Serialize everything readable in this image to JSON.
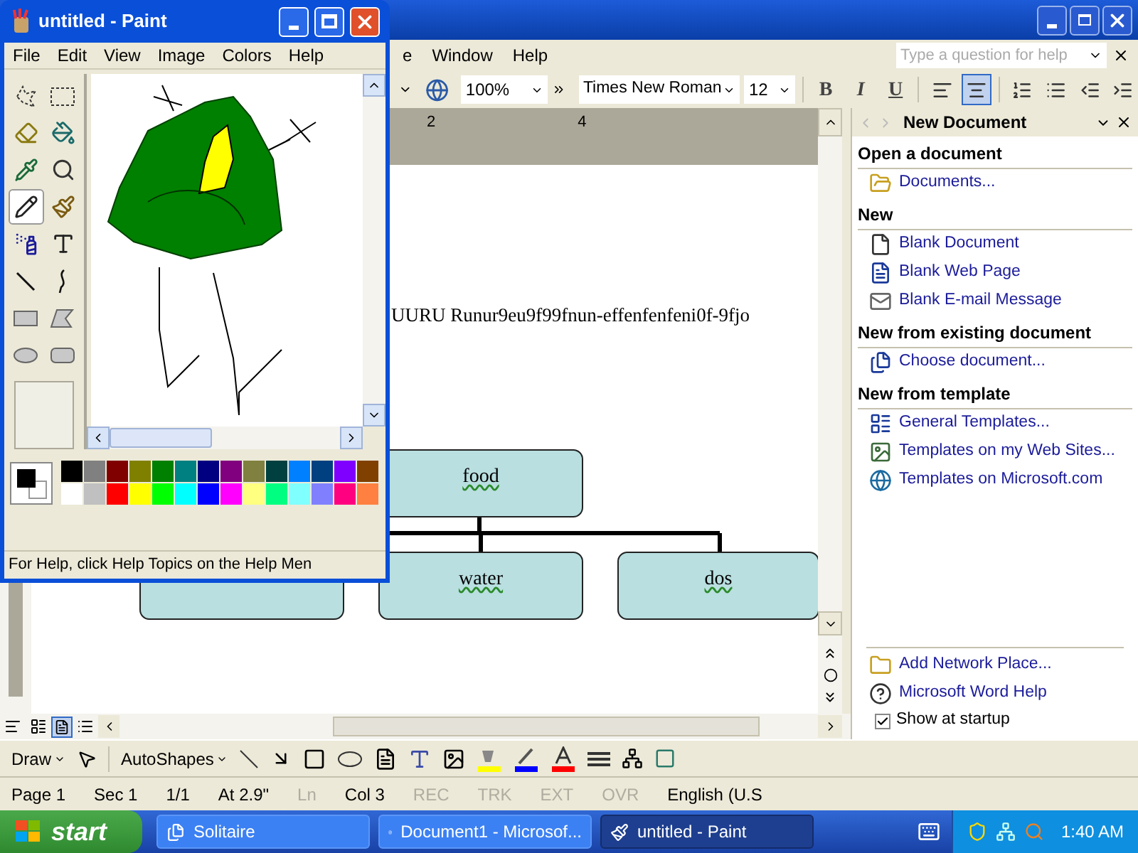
{
  "word": {
    "menu": [
      {
        "label": "e"
      },
      {
        "label": "Window"
      },
      {
        "label": "Help"
      }
    ],
    "help_box": {
      "placeholder": "Type a question for help"
    },
    "toolbar": {
      "zoom": "100%",
      "font": "Times New Roman",
      "size": "12",
      "format_buttons": [
        {
          "kind": "bold",
          "label": "B",
          "selected": false
        },
        {
          "kind": "italic",
          "label": "I",
          "selected": false
        },
        {
          "kind": "underline",
          "label": "U",
          "selected": false
        }
      ],
      "align_buttons": [
        {
          "kind": "left",
          "selected": false
        },
        {
          "kind": "center",
          "selected": true
        }
      ]
    },
    "ruler": {
      "labels": [
        "2",
        "4"
      ]
    },
    "document": {
      "text": "UURU Runur9eu9f99fnun-effenfenfeni0f-9fjo",
      "org_chart": {
        "top": {
          "label": "food"
        },
        "children": [
          {
            "label": "water"
          },
          {
            "label": "dos"
          }
        ]
      }
    },
    "task_pane": {
      "title": "New Document",
      "sections": [
        {
          "heading": "Open a document",
          "items": [
            {
              "kind": "folder",
              "label": "Documents..."
            }
          ]
        },
        {
          "heading": "New",
          "items": [
            {
              "kind": "page",
              "label": "Blank Document"
            },
            {
              "kind": "webpage",
              "label": "Blank Web Page"
            },
            {
              "kind": "mail",
              "label": "Blank E-mail Message"
            }
          ]
        },
        {
          "heading": "New from existing document",
          "items": [
            {
              "kind": "existing",
              "label": "Choose document..."
            }
          ]
        },
        {
          "heading": "New from template",
          "items": [
            {
              "kind": "template",
              "label": "General Templates..."
            },
            {
              "kind": "websites",
              "label": "Templates on my Web Sites..."
            },
            {
              "kind": "globe",
              "label": "Templates on Microsoft.com"
            }
          ]
        }
      ],
      "footer": [
        {
          "kind": "network",
          "label": "Add Network Place..."
        },
        {
          "kind": "help",
          "label": "Microsoft Word Help"
        }
      ],
      "show_at_startup": {
        "label": "Show at startup",
        "checked": true
      }
    },
    "drawing_toolbar": {
      "draw": "Draw",
      "autoshapes": "AutoShapes"
    },
    "status_bar": [
      {
        "text": "Page 1",
        "disabled": false
      },
      {
        "text": "Sec 1",
        "disabled": false
      },
      {
        "text": "1/1",
        "disabled": false
      },
      {
        "text": "At 2.9\"",
        "disabled": false
      },
      {
        "text": "Ln",
        "disabled": true
      },
      {
        "text": "Col 3",
        "disabled": false
      },
      {
        "text": "REC",
        "disabled": true
      },
      {
        "text": "TRK",
        "disabled": true
      },
      {
        "text": "EXT",
        "disabled": true
      },
      {
        "text": "OVR",
        "disabled": true
      },
      {
        "text": "English (U.S",
        "disabled": false
      }
    ]
  },
  "paint": {
    "title": "untitled - Paint",
    "menu": [
      "File",
      "Edit",
      "View",
      "Image",
      "Colors",
      "Help"
    ],
    "tools": [
      {
        "kind": "free-select",
        "selected": false
      },
      {
        "kind": "select",
        "selected": false
      },
      {
        "kind": "eraser",
        "selected": false
      },
      {
        "kind": "fill",
        "selected": false
      },
      {
        "kind": "picker",
        "selected": false
      },
      {
        "kind": "magnifier",
        "selected": false
      },
      {
        "kind": "pencil",
        "selected": true
      },
      {
        "kind": "brush",
        "selected": false
      },
      {
        "kind": "airbrush",
        "selected": false
      },
      {
        "kind": "text",
        "selected": false
      },
      {
        "kind": "line",
        "selected": false
      },
      {
        "kind": "curve",
        "selected": false
      },
      {
        "kind": "rectangle",
        "selected": false
      },
      {
        "kind": "polygon",
        "selected": false
      },
      {
        "kind": "ellipse",
        "selected": false
      },
      {
        "kind": "rounded-rectangle",
        "selected": false
      }
    ],
    "palette": [
      {
        "color": "#000000"
      },
      {
        "color": "#808080"
      },
      {
        "color": "#800000"
      },
      {
        "color": "#808000"
      },
      {
        "color": "#008000"
      },
      {
        "color": "#008080"
      },
      {
        "color": "#000080"
      },
      {
        "color": "#800080"
      },
      {
        "color": "#808040"
      },
      {
        "color": "#004040"
      },
      {
        "color": "#0080ff"
      },
      {
        "color": "#004080"
      },
      {
        "color": "#8000ff"
      },
      {
        "color": "#804000"
      },
      {
        "color": "#ffffff"
      },
      {
        "color": "#c0c0c0"
      },
      {
        "color": "#ff0000"
      },
      {
        "color": "#ffff00"
      },
      {
        "color": "#00ff00"
      },
      {
        "color": "#00ffff"
      },
      {
        "color": "#0000ff"
      },
      {
        "color": "#ff00ff"
      },
      {
        "color": "#ffff80"
      },
      {
        "color": "#00ff80"
      },
      {
        "color": "#80ffff"
      },
      {
        "color": "#8080ff"
      },
      {
        "color": "#ff0080"
      },
      {
        "color": "#ff8040"
      }
    ],
    "status": "For Help, click Help Topics on the Help Men"
  },
  "taskbar": {
    "start": "start",
    "tasks": [
      {
        "kind": "cards",
        "label": "Solitaire",
        "selected": false
      },
      {
        "kind": "word",
        "label": "Document1 - Microsof...",
        "selected": false
      },
      {
        "kind": "paint",
        "label": "untitled - Paint",
        "selected": true
      }
    ],
    "clock": "1:40 AM"
  }
}
